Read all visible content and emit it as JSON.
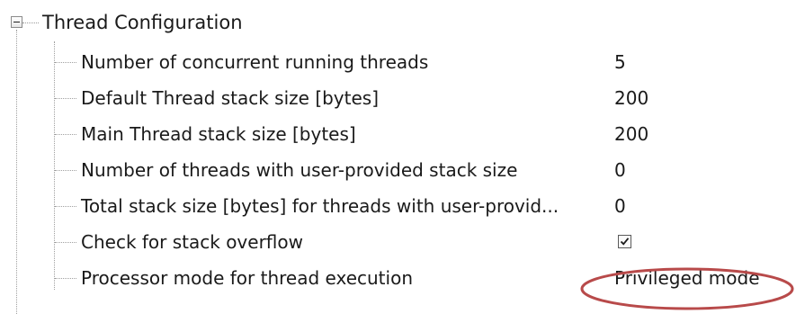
{
  "group": {
    "label": "Thread Configuration",
    "expanded": true,
    "toggle_icon": "minus-box-icon"
  },
  "properties": [
    {
      "name": "Number of concurrent running threads",
      "value": "5"
    },
    {
      "name": "Default Thread stack size [bytes]",
      "value": "200"
    },
    {
      "name": "Main Thread stack size [bytes]",
      "value": "200"
    },
    {
      "name": "Number of threads with user-provided stack size",
      "value": "0"
    },
    {
      "name": "Total stack size [bytes] for threads with user-provid...",
      "value": "0"
    },
    {
      "name": "Check for stack overflow",
      "checked": true
    },
    {
      "name": "Processor mode for thread execution",
      "value": "Privileged mode"
    }
  ],
  "annotation": {
    "shape": "ellipse",
    "color": "#b84a4a",
    "encircles": "Privileged mode"
  },
  "colors": {
    "tree_line": "#a0a0a0",
    "text": "#1a1a1a",
    "background": "#ffffff"
  }
}
